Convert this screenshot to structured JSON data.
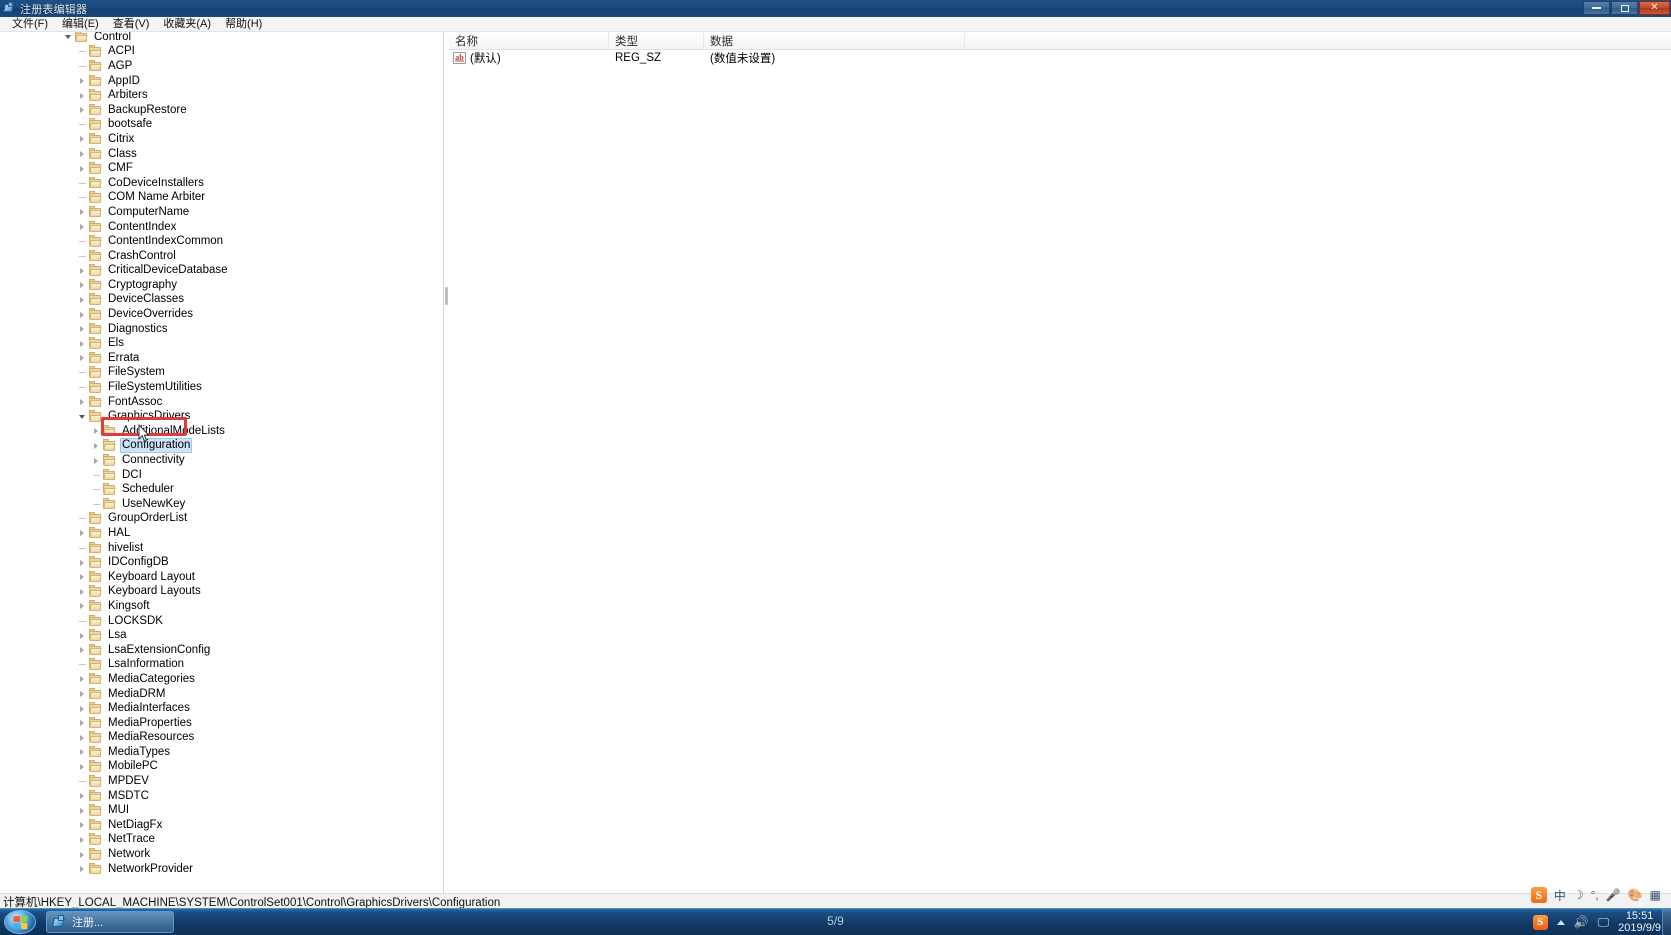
{
  "window": {
    "title": "注册表编辑器",
    "icon": "registry-editor-icon",
    "controls": {
      "minimize": "minimize-button",
      "maximize": "maximize-button",
      "close": "close-button"
    }
  },
  "menubar": {
    "items": [
      {
        "label": "文件(F)",
        "name": "menu-file"
      },
      {
        "label": "编辑(E)",
        "name": "menu-edit"
      },
      {
        "label": "查看(V)",
        "name": "menu-view"
      },
      {
        "label": "收藏夹(A)",
        "name": "menu-favorites"
      },
      {
        "label": "帮助(H)",
        "name": "menu-help"
      }
    ]
  },
  "tree": {
    "selected_key": "Configuration",
    "items": [
      {
        "label": "Control",
        "indent": 0,
        "twisty": "open"
      },
      {
        "label": "ACPI",
        "indent": 1,
        "twisty": "leaf"
      },
      {
        "label": "AGP",
        "indent": 1,
        "twisty": "leaf"
      },
      {
        "label": "AppID",
        "indent": 1,
        "twisty": "closed"
      },
      {
        "label": "Arbiters",
        "indent": 1,
        "twisty": "closed"
      },
      {
        "label": "BackupRestore",
        "indent": 1,
        "twisty": "closed"
      },
      {
        "label": "bootsafe",
        "indent": 1,
        "twisty": "leaf"
      },
      {
        "label": "Citrix",
        "indent": 1,
        "twisty": "closed"
      },
      {
        "label": "Class",
        "indent": 1,
        "twisty": "closed"
      },
      {
        "label": "CMF",
        "indent": 1,
        "twisty": "closed"
      },
      {
        "label": "CoDeviceInstallers",
        "indent": 1,
        "twisty": "leaf"
      },
      {
        "label": "COM Name Arbiter",
        "indent": 1,
        "twisty": "leaf"
      },
      {
        "label": "ComputerName",
        "indent": 1,
        "twisty": "closed"
      },
      {
        "label": "ContentIndex",
        "indent": 1,
        "twisty": "closed"
      },
      {
        "label": "ContentIndexCommon",
        "indent": 1,
        "twisty": "leaf"
      },
      {
        "label": "CrashControl",
        "indent": 1,
        "twisty": "leaf"
      },
      {
        "label": "CriticalDeviceDatabase",
        "indent": 1,
        "twisty": "closed"
      },
      {
        "label": "Cryptography",
        "indent": 1,
        "twisty": "closed"
      },
      {
        "label": "DeviceClasses",
        "indent": 1,
        "twisty": "closed"
      },
      {
        "label": "DeviceOverrides",
        "indent": 1,
        "twisty": "closed"
      },
      {
        "label": "Diagnostics",
        "indent": 1,
        "twisty": "closed"
      },
      {
        "label": "Els",
        "indent": 1,
        "twisty": "closed"
      },
      {
        "label": "Errata",
        "indent": 1,
        "twisty": "closed"
      },
      {
        "label": "FileSystem",
        "indent": 1,
        "twisty": "leaf"
      },
      {
        "label": "FileSystemUtilities",
        "indent": 1,
        "twisty": "leaf"
      },
      {
        "label": "FontAssoc",
        "indent": 1,
        "twisty": "closed"
      },
      {
        "label": "GraphicsDrivers",
        "indent": 1,
        "twisty": "open"
      },
      {
        "label": "AdditionalModeLists",
        "indent": 2,
        "twisty": "closed"
      },
      {
        "label": "Configuration",
        "indent": 2,
        "twisty": "closed",
        "selected": true
      },
      {
        "label": "Connectivity",
        "indent": 2,
        "twisty": "closed"
      },
      {
        "label": "DCI",
        "indent": 2,
        "twisty": "leaf"
      },
      {
        "label": "Scheduler",
        "indent": 2,
        "twisty": "leaf"
      },
      {
        "label": "UseNewKey",
        "indent": 2,
        "twisty": "leaf"
      },
      {
        "label": "GroupOrderList",
        "indent": 1,
        "twisty": "leaf"
      },
      {
        "label": "HAL",
        "indent": 1,
        "twisty": "closed"
      },
      {
        "label": "hivelist",
        "indent": 1,
        "twisty": "leaf"
      },
      {
        "label": "IDConfigDB",
        "indent": 1,
        "twisty": "closed"
      },
      {
        "label": "Keyboard Layout",
        "indent": 1,
        "twisty": "closed"
      },
      {
        "label": "Keyboard Layouts",
        "indent": 1,
        "twisty": "closed"
      },
      {
        "label": "Kingsoft",
        "indent": 1,
        "twisty": "closed"
      },
      {
        "label": "LOCKSDK",
        "indent": 1,
        "twisty": "leaf"
      },
      {
        "label": "Lsa",
        "indent": 1,
        "twisty": "closed"
      },
      {
        "label": "LsaExtensionConfig",
        "indent": 1,
        "twisty": "closed"
      },
      {
        "label": "LsaInformation",
        "indent": 1,
        "twisty": "leaf"
      },
      {
        "label": "MediaCategories",
        "indent": 1,
        "twisty": "closed"
      },
      {
        "label": "MediaDRM",
        "indent": 1,
        "twisty": "closed"
      },
      {
        "label": "MediaInterfaces",
        "indent": 1,
        "twisty": "closed"
      },
      {
        "label": "MediaProperties",
        "indent": 1,
        "twisty": "closed"
      },
      {
        "label": "MediaResources",
        "indent": 1,
        "twisty": "closed"
      },
      {
        "label": "MediaTypes",
        "indent": 1,
        "twisty": "closed"
      },
      {
        "label": "MobilePC",
        "indent": 1,
        "twisty": "closed"
      },
      {
        "label": "MPDEV",
        "indent": 1,
        "twisty": "leaf"
      },
      {
        "label": "MSDTC",
        "indent": 1,
        "twisty": "closed"
      },
      {
        "label": "MUI",
        "indent": 1,
        "twisty": "closed"
      },
      {
        "label": "NetDiagFx",
        "indent": 1,
        "twisty": "closed"
      },
      {
        "label": "NetTrace",
        "indent": 1,
        "twisty": "closed"
      },
      {
        "label": "Network",
        "indent": 1,
        "twisty": "closed"
      },
      {
        "label": "NetworkProvider",
        "indent": 1,
        "twisty": "closed"
      }
    ]
  },
  "values": {
    "columns": [
      "名称",
      "类型",
      "数据"
    ],
    "rows": [
      {
        "icon": "string-value-icon",
        "name": "(默认)",
        "type": "REG_SZ",
        "data": "(数值未设置)"
      }
    ]
  },
  "statusbar": {
    "path": "计算机\\HKEY_LOCAL_MACHINE\\SYSTEM\\ControlSet001\\Control\\GraphicsDrivers\\Configuration"
  },
  "ime": {
    "logo": "S",
    "mode": "中",
    "icons": [
      "moon-icon",
      "keyboard-icon",
      "microphone-icon",
      "palette-icon",
      "toolbox-icon"
    ]
  },
  "taskbar": {
    "start": "start-orb",
    "items": [
      {
        "label": "注册...",
        "icon": "registry-editor-icon"
      }
    ],
    "page_indicator": "5/9",
    "tray": {
      "sogou": "S",
      "volume": "speaker-icon",
      "network": "monitor-icon",
      "time": "15:51",
      "date": "2019/9/9"
    }
  },
  "annotation": {
    "highlight_target": "Configuration",
    "color": "#e03b3b"
  }
}
